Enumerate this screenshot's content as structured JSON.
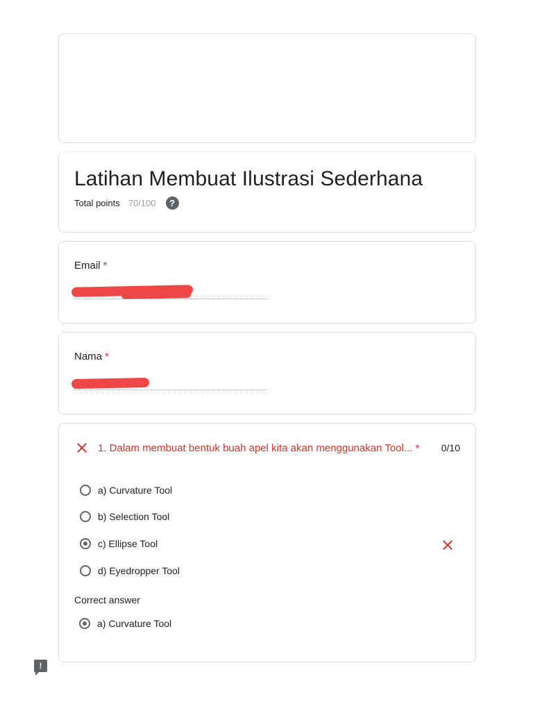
{
  "form": {
    "title": "Latihan Membuat Ilustrasi Sederhana",
    "total_points_label": "Total points",
    "total_points_value": "70/100",
    "help_icon": "help-circle-icon"
  },
  "email": {
    "label": "Email",
    "required_mark": "*"
  },
  "nama": {
    "label": "Nama",
    "required_mark": "*"
  },
  "question1": {
    "status_icon": "close-icon",
    "text": "1. Dalam membuat bentuk buah apel kita akan menggunakan Tool... *",
    "score": "0/10",
    "options": [
      {
        "label": "a) Curvature Tool",
        "selected": false
      },
      {
        "label": "b) Selection Tool",
        "selected": false
      },
      {
        "label": "c) Ellipse Tool",
        "selected": true,
        "incorrect": true
      },
      {
        "label": "d) Eyedropper Tool",
        "selected": false
      }
    ],
    "correct_answer_label": "Correct answer",
    "correct_answer": "a) Curvature Tool"
  },
  "colors": {
    "error": "#d93025",
    "border": "#dadce0",
    "redaction": "#ef4747"
  },
  "feedback_icon": "report-feedback-icon"
}
